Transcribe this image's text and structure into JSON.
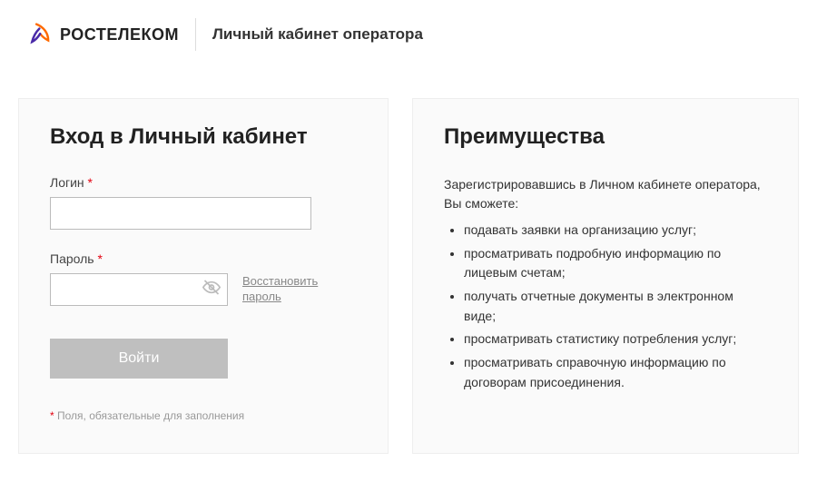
{
  "header": {
    "logo_text": "РОСТЕЛЕКОМ",
    "title": "Личный кабинет оператора"
  },
  "login": {
    "heading": "Вход в Личный кабинет",
    "login_label": "Логин",
    "password_label": "Пароль",
    "restore_link": "Восстановить пароль",
    "submit_label": "Войти",
    "footnote": "Поля, обязательные для заполнения",
    "required_mark": "*"
  },
  "benefits": {
    "heading": "Преимущества",
    "intro": "Зарегистрировавшись в Личном кабинете оператора, Вы сможете:",
    "items": [
      "подавать заявки на организацию услуг;",
      "просматривать подробную информацию по лицевым счетам;",
      "получать отчетные документы в электронном виде;",
      "просматривать статистику потребления услуг;",
      "просматривать справочную информацию по договорам присоединения."
    ]
  }
}
